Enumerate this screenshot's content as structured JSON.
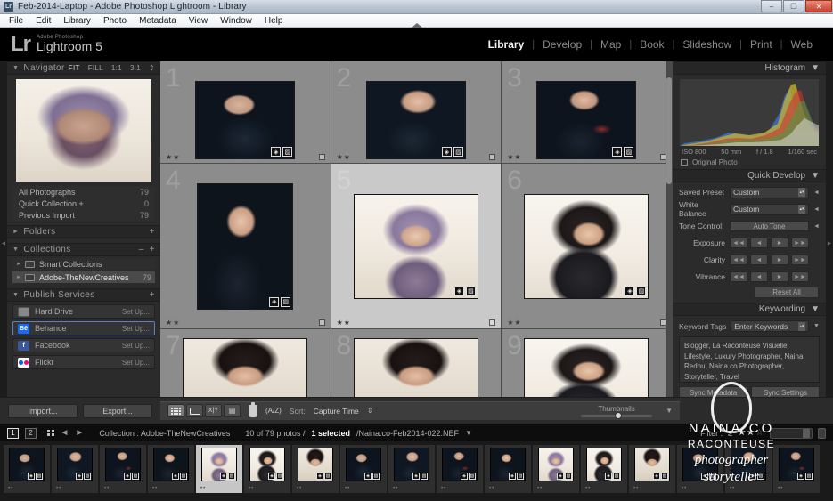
{
  "window": {
    "title": "Feb-2014-Laptop - Adobe Photoshop Lightroom - Library",
    "app_badge": "Lr",
    "minimize": "–",
    "maximize": "❐",
    "close": "✕"
  },
  "menubar": {
    "items": [
      "File",
      "Edit",
      "Library",
      "Photo",
      "Metadata",
      "View",
      "Window",
      "Help"
    ]
  },
  "identity": {
    "mark": "Lr",
    "sub": "Adobe Photoshop",
    "name": "Lightroom 5"
  },
  "modules": {
    "items": [
      "Library",
      "Develop",
      "Map",
      "Book",
      "Slideshow",
      "Print",
      "Web"
    ],
    "active": "Library",
    "separator": "|"
  },
  "left_panel": {
    "navigator": {
      "title": "Navigator",
      "triangle": "▼",
      "zoom_levels": [
        "FIT",
        "FILL",
        "1:1",
        "3:1"
      ],
      "active_zoom": "FIT",
      "stepper": "⇕"
    },
    "catalog": {
      "rows": [
        {
          "label": "All Photographs",
          "count": "79"
        },
        {
          "label": "Quick Collection  +",
          "count": "0"
        },
        {
          "label": "Previous Import",
          "count": "79"
        }
      ]
    },
    "folders": {
      "title": "Folders",
      "triangle": "►",
      "add": "+"
    },
    "collections": {
      "title": "Collections",
      "triangle": "▼",
      "remove": "–",
      "add": "+",
      "rows": [
        {
          "label": "Smart Collections",
          "count": "",
          "triangle": "►",
          "selected": false
        },
        {
          "label": "Adobe-TheNewCreatives",
          "count": "79",
          "triangle": "►",
          "selected": true
        }
      ]
    },
    "publish_services": {
      "title": "Publish Services",
      "triangle": "▼",
      "add": "+",
      "rows": [
        {
          "label": "Hard Drive",
          "action": "Set Up...",
          "icon": "hard-drive-icon",
          "selected": false
        },
        {
          "label": "Behance",
          "action": "Set Up...",
          "icon": "behance-icon",
          "selected": true
        },
        {
          "label": "Facebook",
          "action": "Set Up...",
          "icon": "facebook-icon",
          "selected": false
        },
        {
          "label": "Flickr",
          "action": "Set Up...",
          "icon": "flickr-icon",
          "selected": false
        }
      ]
    },
    "buttons": {
      "import": "Import...",
      "export": "Export..."
    }
  },
  "grid": {
    "cells": [
      {
        "index": "1",
        "stars": "★★",
        "photo": "ph-a",
        "selected": false,
        "partial_top": true
      },
      {
        "index": "2",
        "stars": "★★",
        "photo": "ph-b",
        "selected": false,
        "partial_top": true
      },
      {
        "index": "3",
        "stars": "★★",
        "photo": "ph-c",
        "selected": false,
        "partial_top": true
      },
      {
        "index": "4",
        "stars": "★★",
        "photo": "ph-d",
        "selected": false,
        "partial_top": false
      },
      {
        "index": "5",
        "stars": "★★",
        "photo": "ph-e",
        "selected": true,
        "partial_top": false
      },
      {
        "index": "6",
        "stars": "★★",
        "photo": "ph-f",
        "selected": false,
        "partial_top": false
      },
      {
        "index": "7",
        "stars": "",
        "photo": "ph-g",
        "selected": false,
        "partial_top": false
      },
      {
        "index": "8",
        "stars": "",
        "photo": "ph-g",
        "selected": false,
        "partial_top": false
      },
      {
        "index": "9",
        "stars": "",
        "photo": "ph-f",
        "selected": false,
        "partial_top": false
      }
    ],
    "badge_keyword": "◈",
    "badge_crop": "▨"
  },
  "right_panel": {
    "histogram": {
      "title": "Histogram",
      "triangle": "▼",
      "iso": "ISO 800",
      "focal": "50 mm",
      "aperture": "f / 1.8",
      "shutter": "1/160 sec",
      "original_photo": "Original Photo"
    },
    "quick_develop": {
      "title": "Quick Develop",
      "triangle": "▼",
      "saved_preset_label": "Saved Preset",
      "saved_preset_value": "Custom",
      "white_balance_label": "White Balance",
      "white_balance_value": "Custom",
      "tone_control_label": "Tone Control",
      "auto_tone": "Auto Tone",
      "sliders": [
        {
          "label": "Exposure",
          "steps": [
            "◄◄",
            "◄",
            "►",
            "►►"
          ]
        },
        {
          "label": "Clarity",
          "steps": [
            "◄◄",
            "◄",
            "►",
            "►►"
          ]
        },
        {
          "label": "Vibrance",
          "steps": [
            "◄◄",
            "◄",
            "►",
            "►►"
          ]
        }
      ],
      "reset_all": "Reset All"
    },
    "keywording": {
      "title": "Keywording",
      "triangle": "▼",
      "tags_label": "Keyword Tags",
      "tags_value": "Enter Keywords",
      "keywords": "Blogger, La Raconteuse Visuelle, Lifestyle, Luxury Photographer, Naina Redhu, Naina.co Photographer, Storyteller, Travel"
    },
    "sync": {
      "metadata": "Sync Metadata",
      "settings": "Sync Settings"
    }
  },
  "toolbar": {
    "view_modes": [
      {
        "name": "grid-view",
        "glyph": "grid",
        "active": true
      },
      {
        "name": "loupe-view",
        "glyph": "loupe",
        "active": false
      },
      {
        "name": "compare-view",
        "glyph": "X|Y",
        "active": false
      },
      {
        "name": "survey-view",
        "glyph": "survey",
        "active": false
      }
    ],
    "spray_can": "spray-can-icon",
    "sort_direction": "A\nZ",
    "sort_label": "Sort:",
    "sort_value": "Capture Time",
    "sort_stepper": "⇕",
    "thumbnails_label": "Thumbnails",
    "thumbnails_value": "50",
    "caret": "▼"
  },
  "statusbar": {
    "page_buttons": [
      "1",
      "2"
    ],
    "back_arrow": "◄",
    "forward_arrow": "►",
    "source": "Collection : Adobe-TheNewCreatives",
    "count": "10 of 79 photos /",
    "selected": "1 selected",
    "filename": "/Naina.co-Feb2014-022.NEF",
    "caret": "▼",
    "filter_label": "Filter :",
    "filter_operator": "≥",
    "stars_on": "★★",
    "stars_off": "☆"
  },
  "filmstrip": {
    "cells": [
      {
        "photo": "ph-a",
        "stars": "••",
        "selected": false
      },
      {
        "photo": "ph-b",
        "stars": "••",
        "selected": false
      },
      {
        "photo": "ph-c",
        "stars": "••",
        "selected": false
      },
      {
        "photo": "ph-d",
        "stars": "••",
        "selected": false
      },
      {
        "photo": "ph-e",
        "stars": "••",
        "selected": true
      },
      {
        "photo": "ph-f",
        "stars": "••",
        "selected": false
      },
      {
        "photo": "ph-g",
        "stars": "••",
        "selected": false
      },
      {
        "photo": "ph-a",
        "stars": "••",
        "selected": false
      },
      {
        "photo": "ph-b",
        "stars": "••",
        "selected": false
      },
      {
        "photo": "ph-c",
        "stars": "••",
        "selected": false
      },
      {
        "photo": "ph-d",
        "stars": "••",
        "selected": false
      },
      {
        "photo": "ph-e",
        "stars": "••",
        "selected": false
      },
      {
        "photo": "ph-f",
        "stars": "••",
        "selected": false
      },
      {
        "photo": "ph-g",
        "stars": "••",
        "selected": false
      },
      {
        "photo": "ph-a",
        "stars": "••",
        "selected": false
      },
      {
        "photo": "ph-b",
        "stars": "••",
        "selected": false
      },
      {
        "photo": "ph-c",
        "stars": "••",
        "selected": false
      }
    ]
  },
  "watermark": {
    "name": "NAINA.CO",
    "sub": "RACONTEUSE",
    "role1": "photographer",
    "role2": "storyteller"
  },
  "colors": {
    "accent": "#5f7fbf",
    "panel_bg": "#2b2b2b",
    "grid_bg": "#5c5c5c",
    "cell_bg": "#8c8c8c",
    "cell_selected": "#c9c9c9",
    "close_btn": "#c8402c"
  }
}
